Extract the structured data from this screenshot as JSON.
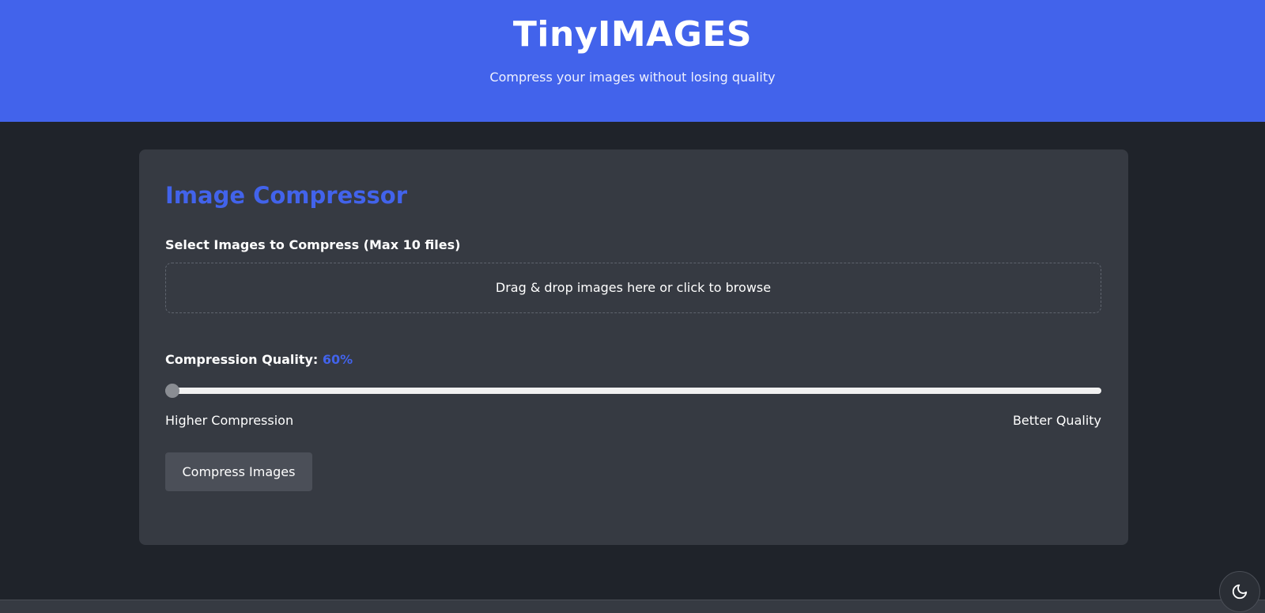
{
  "header": {
    "title": "TinyIMAGES",
    "subtitle": "Compress your images without losing quality"
  },
  "card": {
    "title": "Image Compressor",
    "select_label": "Select Images to Compress (Max 10 files)",
    "dropzone_text": "Drag & drop images here or click to browse",
    "quality_label": "Compression Quality:",
    "quality_value": "60%",
    "slider_fraction": 0,
    "range_left": "Higher Compression",
    "range_right": "Better Quality",
    "compress_label": "Compress Images"
  },
  "theme_toggle": {
    "icon": "moon-icon"
  },
  "colors": {
    "accent": "#4263eb",
    "background": "#1f232a",
    "card": "#363a42"
  }
}
